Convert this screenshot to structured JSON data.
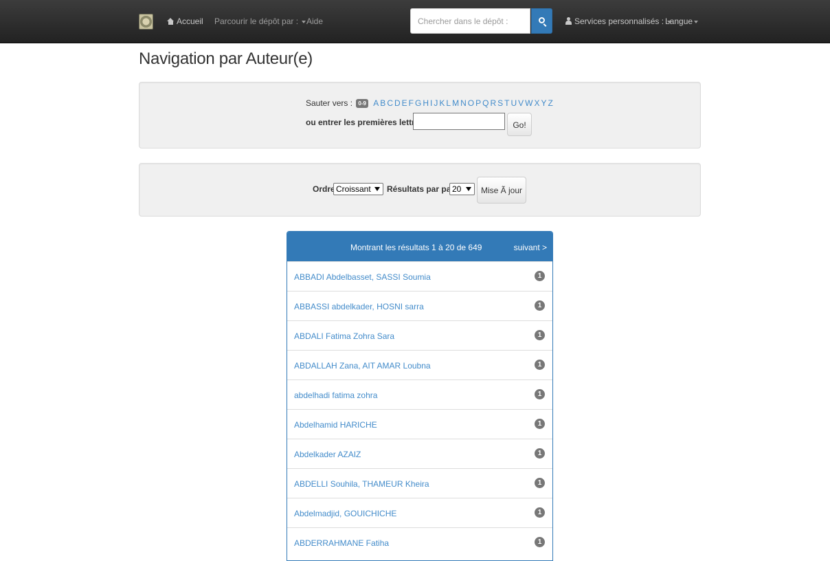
{
  "navbar": {
    "home": "Accueil",
    "browse": "Parcourir le dépôt par :",
    "help": "Aide",
    "search_placeholder": "Chercher dans le dépôt :",
    "services": "Services personnalisés :",
    "language": "Langue"
  },
  "page": {
    "title": "Navigation par Auteur(e)"
  },
  "jump": {
    "label": "Sauter vers :",
    "badge": "0-9",
    "letters": [
      "A",
      "B",
      "C",
      "D",
      "E",
      "F",
      "G",
      "H",
      "I",
      "J",
      "K",
      "L",
      "M",
      "N",
      "O",
      "P",
      "Q",
      "R",
      "S",
      "T",
      "U",
      "V",
      "W",
      "X",
      "Y",
      "Z"
    ],
    "starts_label": "ou entrer les premières lettres :",
    "starts_value": "",
    "go": "Go!"
  },
  "sort": {
    "order_label": "Ordre",
    "order_value": "Croissant",
    "rpp_label": "Résultats par page",
    "rpp_value": "20",
    "update": "Mise Ã  jour"
  },
  "results": {
    "summary": "Montrant les résultats 1 à 20 de 649",
    "next": "suivant >",
    "items": [
      {
        "name": "ABBADI Abdelbasset, SASSI Soumia",
        "count": "1"
      },
      {
        "name": "ABBASSI abdelkader, HOSNI sarra",
        "count": "1"
      },
      {
        "name": "ABDALI Fatima Zohra Sara",
        "count": "1"
      },
      {
        "name": "ABDALLAH Zana, AIT AMAR Loubna",
        "count": "1"
      },
      {
        "name": "abdelhadi fatima zohra",
        "count": "1"
      },
      {
        "name": "Abdelhamid HARICHE",
        "count": "1"
      },
      {
        "name": "Abdelkader AZAIZ",
        "count": "1"
      },
      {
        "name": "ABDELLI Souhila, THAMEUR Kheira",
        "count": "1"
      },
      {
        "name": "Abdelmadjid, GOUICHICHE",
        "count": "1"
      },
      {
        "name": "ABDERRAHMANE Fatiha",
        "count": "1"
      }
    ]
  }
}
